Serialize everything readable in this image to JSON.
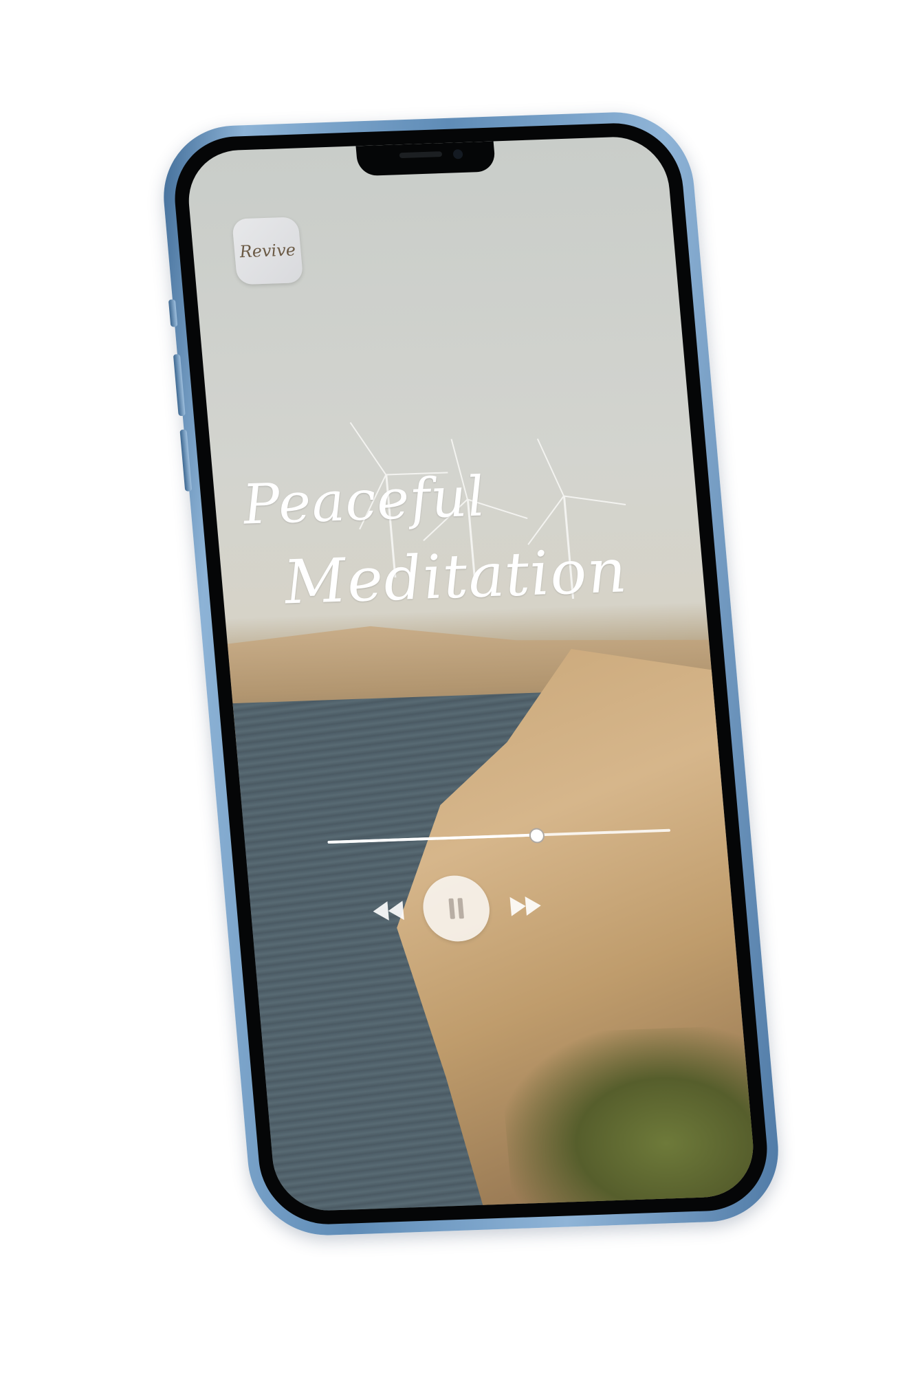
{
  "app": {
    "logo_text": "Revive"
  },
  "title": {
    "line1": "Peaceful",
    "line2": "Meditation"
  },
  "player": {
    "progress": 0.61
  },
  "controls": {
    "rewind_icon": "rewind-icon",
    "pause_icon": "pause-icon",
    "forward_icon": "fast-forward-icon"
  },
  "colors": {
    "phone_frame": "#6f98c2",
    "title_text": "#ffffff",
    "pause_button": "#faf8f5"
  }
}
